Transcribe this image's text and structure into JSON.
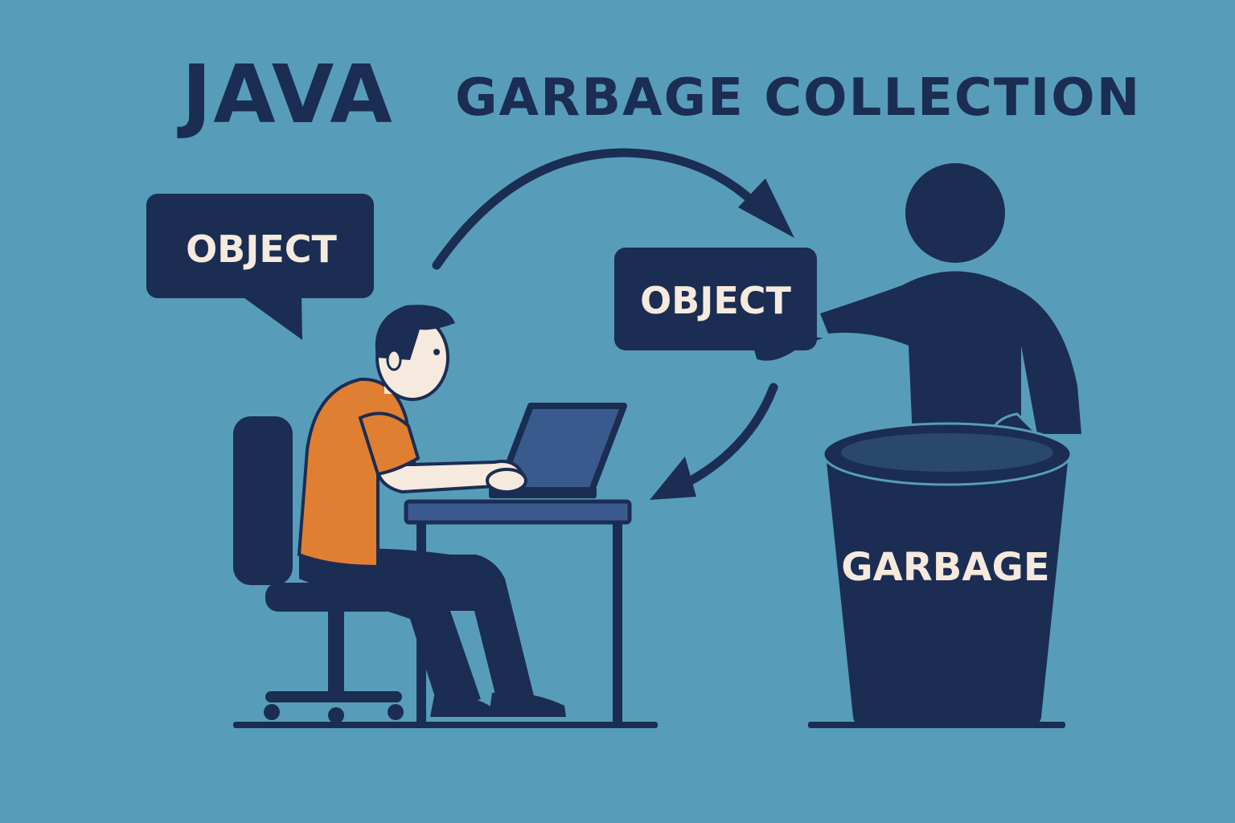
{
  "title": {
    "java": "JAVA",
    "rest": "GARBAGE COLLECTION"
  },
  "labels": {
    "speech_bubble": "OBJECT",
    "held_object": "OBJECT",
    "bin": "GARBAGE"
  },
  "colors": {
    "background": "#579dba",
    "navy": "#1b2d52",
    "shirt_orange": "#e07f32",
    "skin": "#f6e9dd",
    "laptop_screen": "#3a5a8e"
  }
}
